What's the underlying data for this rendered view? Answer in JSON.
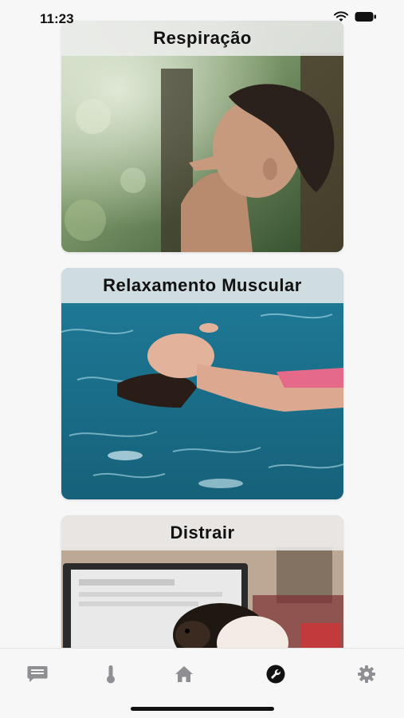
{
  "status_bar": {
    "time": "11:23",
    "icons": [
      "wifi-icon",
      "battery-icon"
    ]
  },
  "cards": [
    {
      "title": "Respiração",
      "image": "woman-breathing-in-forest"
    },
    {
      "title": "Relaxamento Muscular",
      "image": "woman-floating-in-pool"
    },
    {
      "title": "Distrair",
      "image": "guinea-pig-in-front-of-laptop"
    }
  ],
  "tab_bar": {
    "items": [
      {
        "icon": "chat-icon",
        "active": false
      },
      {
        "icon": "thermometer-icon",
        "active": false
      },
      {
        "icon": "home-icon",
        "active": false
      },
      {
        "icon": "wrench-icon",
        "active": true
      },
      {
        "icon": "gear-icon",
        "active": false
      }
    ],
    "active_color": "#111111",
    "inactive_color": "#8e8e93"
  }
}
